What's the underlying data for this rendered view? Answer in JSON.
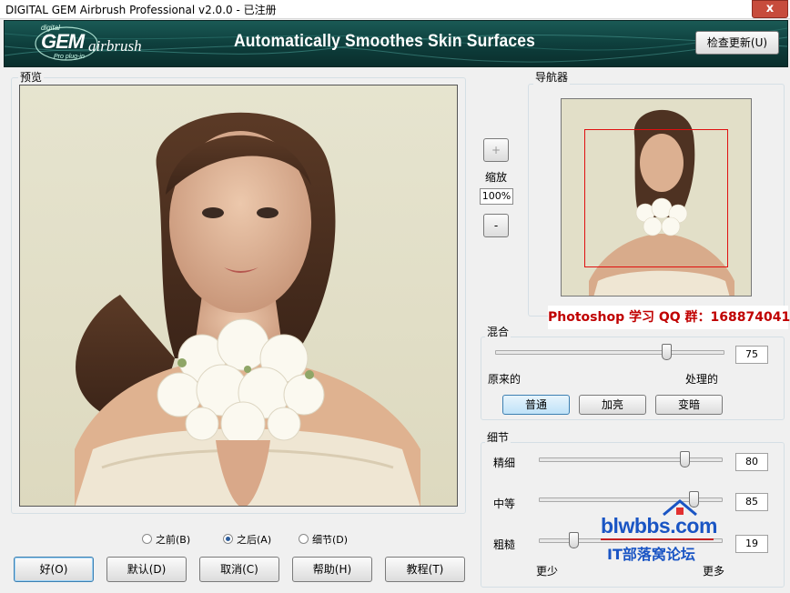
{
  "window": {
    "title": "DIGITAL GEM Airbrush Professional v2.0.0 - 已注册",
    "close_label": "x"
  },
  "banner": {
    "logo_small": "digital",
    "logo_main": "GEM",
    "logo_script": "airbrush",
    "logo_sub": "Pro plug-in",
    "tagline": "Automatically Smoothes Skin Surfaces",
    "update_button": "检查更新(U)"
  },
  "preview": {
    "label": "预览"
  },
  "navigator": {
    "label": "导航器"
  },
  "zoom": {
    "plus": "+",
    "label": "缩放",
    "value": "100%",
    "minus": "-"
  },
  "watermark_qq": "Photoshop 学习 QQ 群：168874041",
  "blend": {
    "label": "混合",
    "value": "75",
    "level": 0.75,
    "left_label": "原来的",
    "right_label": "处理的",
    "modes": [
      "普通",
      "加亮",
      "变暗"
    ],
    "selected_mode": "普通"
  },
  "detail": {
    "label": "细节",
    "sliders": [
      {
        "label": "精细",
        "value": "80",
        "level": 0.8
      },
      {
        "label": "中等",
        "value": "85",
        "level": 0.85
      },
      {
        "label": "粗糙",
        "value": "19",
        "level": 0.19
      }
    ],
    "min_label": "更少",
    "max_label": "更多"
  },
  "view_options": {
    "before": "之前(B)",
    "after": "之后(A)",
    "detail": "细节(D)",
    "selected": "after"
  },
  "buttons": {
    "ok": "好(O)",
    "default": "默认(D)",
    "cancel": "取消(C)",
    "help": "帮助(H)",
    "tutorial": "教程(T)"
  },
  "site_watermark": {
    "name": "blwbbs.com",
    "subtitle": "IT部落窝论坛"
  }
}
